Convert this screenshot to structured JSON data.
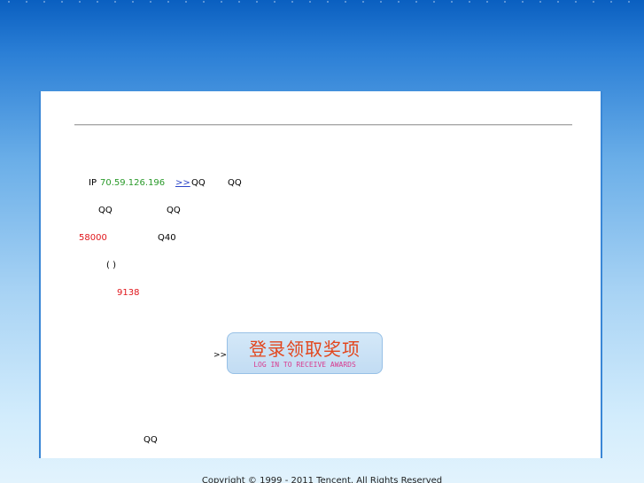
{
  "content": {
    "ip_label": "IP",
    "ip_address": "70.59.126.196",
    "more_link": ">>",
    "qq_1": "QQ",
    "qq_2": "QQ",
    "qq_3": "QQ",
    "qq_4": "QQ",
    "amount": "58000",
    "q_value": "Q40",
    "parens": "(    )",
    "count": "9138",
    "arrow": ">>",
    "qq_bottom": "QQ"
  },
  "award_button": {
    "title_cn": "登录领取奖项",
    "subtitle_en": "LOG IN TO RECEIVE AWARDS"
  },
  "footer": {
    "copyright": "Copyright © 1999 - 2011 Tencent. All Rights Reserved"
  },
  "colors": {
    "ip_green": "#2a9a2a",
    "highlight_red": "#e0161b",
    "link_blue": "#2b45c8",
    "award_orange": "#e2461d",
    "award_pink": "#d83b8f"
  }
}
